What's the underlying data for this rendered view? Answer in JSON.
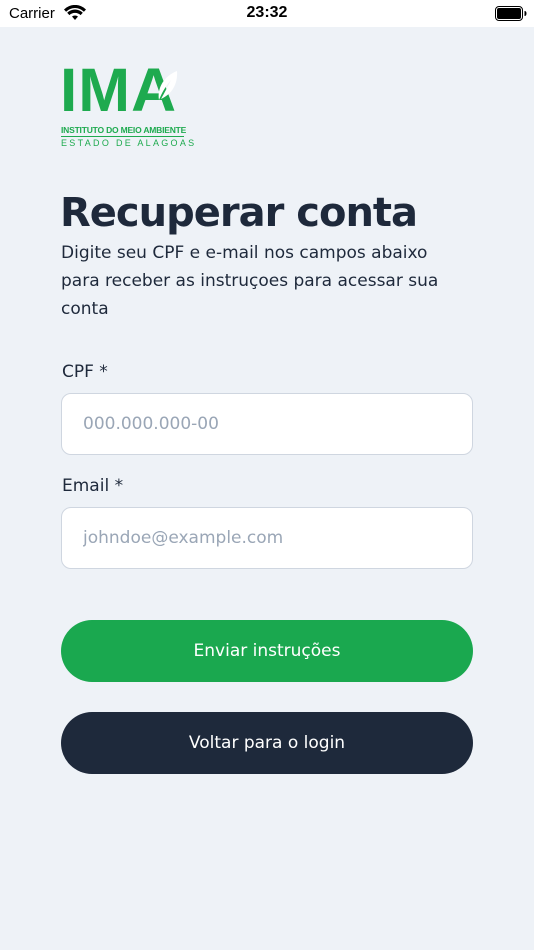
{
  "status_bar": {
    "carrier": "Carrier",
    "time": "23:32"
  },
  "logo": {
    "letters": "IMA",
    "line1": "INSTITUTO DO MEIO AMBIENTE",
    "line2": "ESTADO DE ALAGOAS"
  },
  "header": {
    "title": "Recuperar conta",
    "subtitle": "Digite seu CPF e e-mail nos campos abaixo para receber as instruçoes para acessar sua conta"
  },
  "form": {
    "cpf": {
      "label": "CPF *",
      "value": "",
      "placeholder": "000.000.000-00"
    },
    "email": {
      "label": "Email *",
      "value": "",
      "placeholder": "johndoe@example.com"
    }
  },
  "actions": {
    "submit_label": "Enviar instruções",
    "back_label": "Voltar para o login"
  },
  "colors": {
    "brand_green": "#1aa84f",
    "dark_navy": "#1e293b",
    "background": "#eef2f7"
  },
  "icons": [
    "wifi-icon",
    "battery-icon",
    "leaf-icon"
  ]
}
